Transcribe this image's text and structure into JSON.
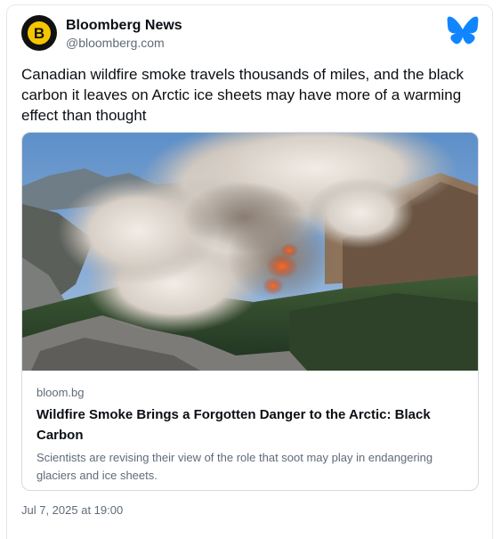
{
  "author": {
    "display_name": "Bloomberg News",
    "handle": "@bloomberg.com",
    "avatar_letter": "B",
    "avatar_bg": "#111111",
    "avatar_accent": "#f5c600"
  },
  "app_icon": "bluesky-butterfly-icon",
  "accent_color": "#1185fe",
  "post": {
    "text": "Canadian wildfire smoke travels thousands of miles, and the black carbon it leaves on Arctic ice sheets may have more of a warming effect than thought",
    "timestamp": "Jul 7, 2025 at 19:00"
  },
  "link_card": {
    "domain": "bloom.bg",
    "title": "Wildfire Smoke Brings a Forgotten Danger to the Arctic: Black Carbon",
    "description": "Scientists are revising their view of the role that soot may play in endangering glaciers and ice sheets."
  }
}
